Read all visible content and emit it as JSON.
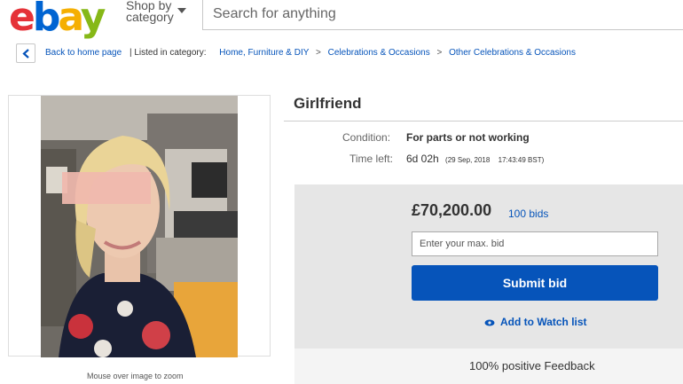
{
  "header": {
    "logo_letters": [
      "e",
      "b",
      "a",
      "y"
    ],
    "shop_by_line1": "Shop by",
    "shop_by_line2": "category",
    "search_placeholder": "Search for anything"
  },
  "breadcrumb": {
    "back_label": "Back to home page",
    "listed_in": "| Listed in category:",
    "categories": [
      "Home, Furniture & DIY",
      "Celebrations & Occasions",
      "Other Celebrations & Occasions"
    ],
    "separator": ">"
  },
  "listing": {
    "image_hint": "Mouse over image to zoom",
    "title": "Girlfriend",
    "condition_label": "Condition:",
    "condition_value": "For parts or not working",
    "time_left_label": "Time left:",
    "time_left_value": "6d 02h",
    "time_left_date": "(29 Sep, 2018",
    "time_left_time": "17:43:49 BST)"
  },
  "bidding": {
    "price": "£70,200.00",
    "bids": "100 bids",
    "max_bid_placeholder": "Enter your max. bid",
    "submit_label": "Submit bid",
    "watch_label": "Add to Watch list",
    "feedback": "100% positive Feedback"
  },
  "colors": {
    "accent": "#0654ba",
    "logo_e": "#e53238",
    "logo_b": "#0064d2",
    "logo_a": "#f5af02",
    "logo_y": "#86b817"
  },
  "icons": {
    "back": "chevron-left-icon",
    "dropdown": "caret-down-icon",
    "watch": "eye-icon"
  }
}
